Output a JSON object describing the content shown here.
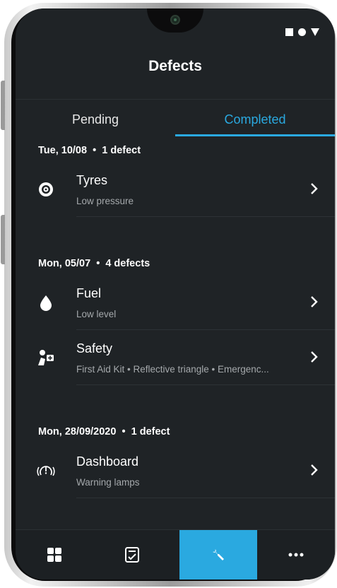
{
  "header": {
    "title": "Defects"
  },
  "tabs": [
    {
      "label": "Pending",
      "active": false
    },
    {
      "label": "Completed",
      "active": true
    }
  ],
  "groups": [
    {
      "date": "Tue, 10/08",
      "count": "1 defect",
      "items": [
        {
          "icon": "tyre-icon",
          "name": "Tyres",
          "detail": "Low pressure"
        }
      ]
    },
    {
      "date": "Mon, 05/07",
      "count": "4 defects",
      "items": [
        {
          "icon": "drop-icon",
          "name": "Fuel",
          "detail": "Low level"
        },
        {
          "icon": "first-aid-person-icon",
          "name": "Safety",
          "detail": "First Aid Kit • Reflective triangle • Emergenc..."
        }
      ]
    },
    {
      "date": "Mon, 28/09/2020",
      "count": "1 defect",
      "items": [
        {
          "icon": "dashboard-warning-icon",
          "name": "Dashboard",
          "detail": "Warning lamps"
        }
      ]
    }
  ],
  "bottom_nav": [
    {
      "icon": "grid-icon",
      "active": false
    },
    {
      "icon": "checklist-icon",
      "active": false
    },
    {
      "icon": "wrench-icon",
      "active": true
    },
    {
      "icon": "more-icon",
      "active": false
    }
  ],
  "colors": {
    "accent": "#2aa9e0",
    "background": "#1f2326",
    "subtext": "#a4a8ab"
  }
}
